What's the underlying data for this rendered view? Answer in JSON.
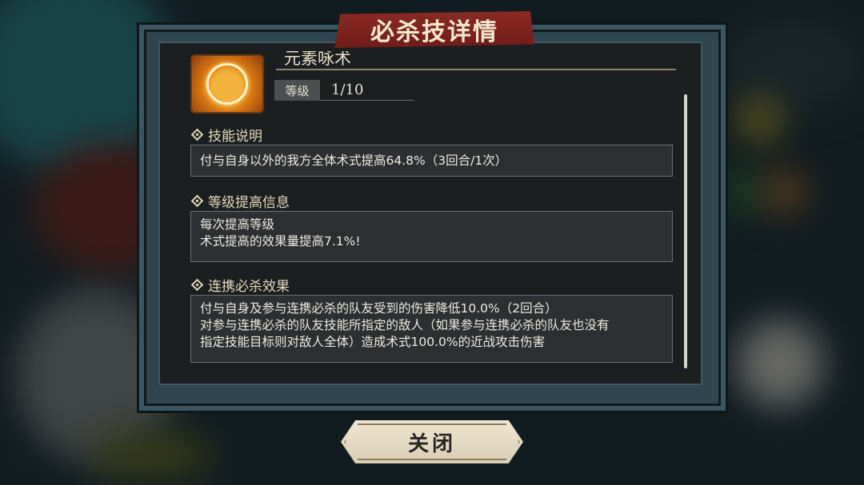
{
  "dialog": {
    "title": "必杀技详情",
    "skill_name": "元素咏术",
    "level_label": "等级",
    "level_value": "1/10"
  },
  "sections": [
    {
      "heading": "技能说明",
      "lines": [
        "付与自身以外的我方全体术式提高64.8%（3回合/1次）"
      ]
    },
    {
      "heading": "等级提高信息",
      "lines": [
        "每次提高等级",
        "术式提高的效果量提高7.1%!"
      ]
    },
    {
      "heading": "连携必杀效果",
      "lines": [
        "付与自身及参与连携必杀的队友受到的伤害降低10.0%（2回合）",
        "对参与连携必杀的队友技能所指定的敌人（如果参与连携必杀的队友也没有",
        "指定技能目标则对敌人全体）造成术式100.0%的近战攻击伤害"
      ]
    }
  ],
  "buttons": {
    "close": "关闭"
  },
  "icons": {
    "skill": "skill-emblem-icon",
    "section_marker": "diamond-icon"
  }
}
